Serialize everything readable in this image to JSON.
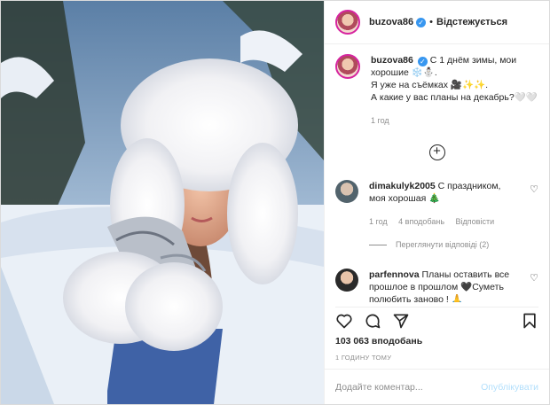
{
  "header": {
    "username": "buzova86",
    "separator": "•",
    "follow_label": "Відстежується"
  },
  "caption": {
    "username": "buzova86",
    "line1": "С 1 днём зимы, мои хорошие ❄️⛄.",
    "line2": "Я уже на съёмках 🎥✨✨.",
    "line3": "А какие у вас планы на декабрь?🤍🤍",
    "time": "1 год"
  },
  "comments": [
    {
      "username": "dimakulyk2005",
      "text": "С праздником, моя хорошая 🎄",
      "time": "1 год",
      "likes": "4 вподобань",
      "reply": "Відповісти",
      "view_replies": "Переглянути відповіді (2)"
    },
    {
      "username": "parfennova",
      "text": "Планы оставить все прошлое в прошлом 🖤Суметь полюбить заново ! 🙏"
    }
  ],
  "likes": "103 063 вподобань",
  "post_time": "1 ГОДИНУ ТОМУ",
  "comment_input": {
    "placeholder": "Додайте коментар...",
    "publish_label": "Опублікувати"
  },
  "icons": {
    "verified": "verified-badge-icon",
    "like": "heart-icon",
    "comment": "comment-icon",
    "share": "share-icon",
    "save": "bookmark-icon",
    "add_comments": "plus-circle-icon"
  },
  "colors": {
    "accent": "#3897f0",
    "publish_disabled": "#b2dffc",
    "muted": "#8e8e8e"
  }
}
